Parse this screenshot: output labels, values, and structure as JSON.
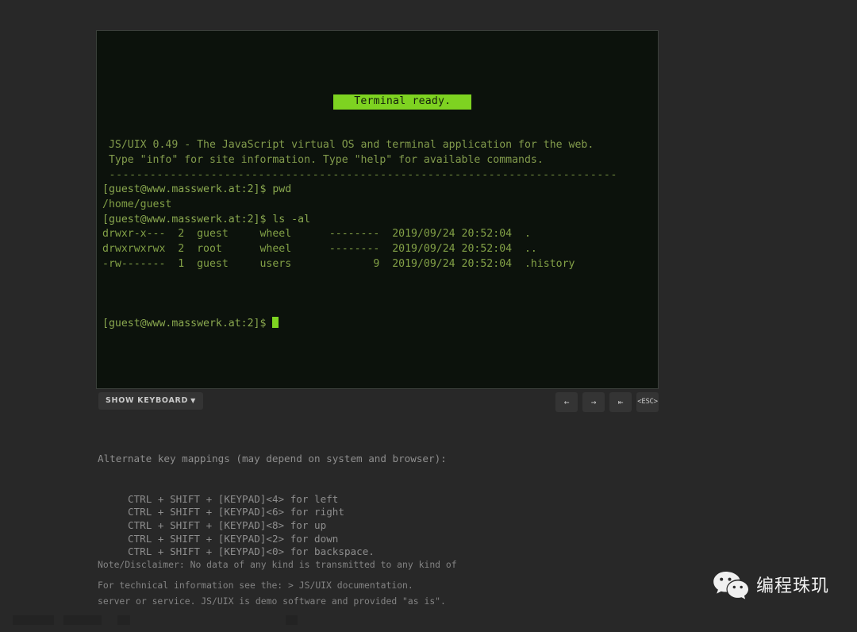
{
  "page": {
    "background_color": "#282828"
  },
  "terminal": {
    "banner": "Terminal ready.",
    "banner_bg": "#7ed321",
    "banner_fg": "#14200c",
    "screen_bg": "#0c120c",
    "text_color": "#7f9a43",
    "cursor_color": "#7ed321",
    "lines": [
      {
        "kind": "intro",
        "text": " JS/UIX 0.49 - The JavaScript virtual OS and terminal application for the web."
      },
      {
        "kind": "intro",
        "text": " Type \"info\" for site information. Type \"help\" for available commands."
      },
      {
        "kind": "rule",
        "text": " ---------------------------------------------------------------------------"
      },
      {
        "kind": "cmd",
        "text": "[guest@www.masswerk.at:2]$ pwd"
      },
      {
        "kind": "out",
        "text": "/home/guest"
      },
      {
        "kind": "cmd",
        "text": "[guest@www.masswerk.at:2]$ ls -al"
      },
      {
        "kind": "out",
        "text": "drwxr-x---  2  guest     wheel      --------  2019/09/24 20:52:04  ."
      },
      {
        "kind": "out",
        "text": "drwxrwxrwx  2  root      wheel      --------  2019/09/24 20:52:04  .."
      },
      {
        "kind": "out",
        "text": "-rw-------  1  guest     users             9  2019/09/24 20:52:04  .history"
      }
    ],
    "prompt": "[guest@www.masswerk.at:2]$ "
  },
  "controls": {
    "show_keyboard_label": "SHOW KEYBOARD",
    "show_keyboard_caret": "▼",
    "keys": [
      {
        "name": "arrow-left",
        "glyph": "←"
      },
      {
        "name": "arrow-right",
        "glyph": "→"
      },
      {
        "name": "backspace-arrow",
        "glyph": "⇤"
      },
      {
        "name": "escape",
        "glyph": "<ESC>"
      }
    ]
  },
  "info": {
    "heading": "Alternate key mappings (may depend on system and browser):",
    "mappings": [
      "CTRL + SHIFT + [KEYPAD]<4> for left",
      "CTRL + SHIFT + [KEYPAD]<6> for right",
      "CTRL + SHIFT + [KEYPAD]<8> for up",
      "CTRL + SHIFT + [KEYPAD]<2> for down",
      "CTRL + SHIFT + [KEYPAD]<0> for backspace."
    ]
  },
  "disclaimer": {
    "line1": "Note/Disclaimer: No data of any kind is transmitted to any kind of",
    "line2": "server or service. JS/UIX is demo software and provided \"as is\"."
  },
  "tech_info": {
    "prefix": "For technical information see the: > ",
    "link_text": "JS/UIX documentation",
    "suffix": "."
  },
  "watermark": {
    "icon": "wechat-icon",
    "label": "编程珠玑"
  }
}
